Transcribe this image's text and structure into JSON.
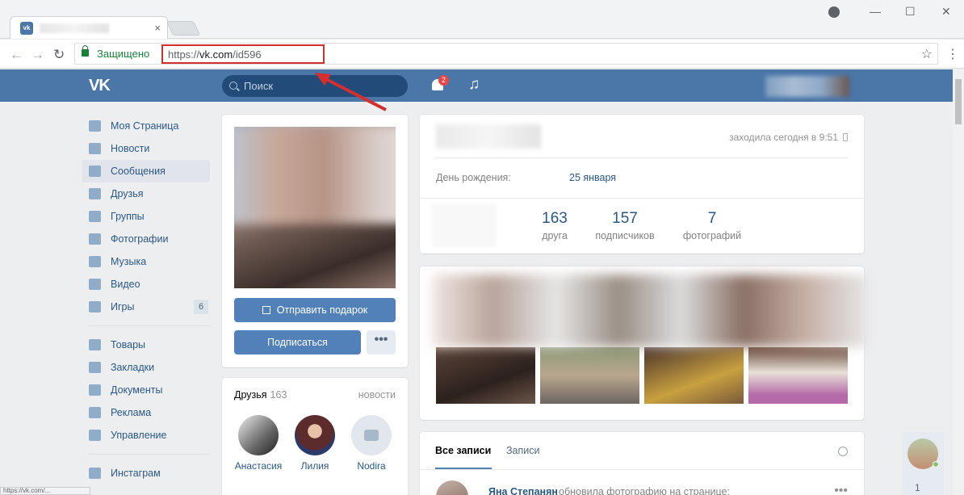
{
  "browser": {
    "url_scheme": "https://",
    "url_domain": "vk.com",
    "url_path": "/id596",
    "secure_label": "Защищено",
    "close_glyph": "×",
    "min_glyph": "—",
    "max_glyph": "☐",
    "win_close_glyph": "✕",
    "back_glyph": "←",
    "forward_glyph": "→",
    "reload_glyph": "↻",
    "star_glyph": "☆",
    "menu_glyph": "⋮",
    "status_url": "https://vk.com/..."
  },
  "header": {
    "logo": "VK",
    "search_placeholder": "Поиск",
    "notifications_count": "2",
    "music_glyph": "♫"
  },
  "menu": {
    "items": [
      {
        "label": "Моя Страница"
      },
      {
        "label": "Новости"
      },
      {
        "label": "Сообщения"
      },
      {
        "label": "Друзья"
      },
      {
        "label": "Группы"
      },
      {
        "label": "Фотографии"
      },
      {
        "label": "Музыка"
      },
      {
        "label": "Видео"
      },
      {
        "label": "Игры",
        "count": "6"
      }
    ],
    "secondary": [
      {
        "label": "Товары"
      },
      {
        "label": "Закладки"
      },
      {
        "label": "Документы"
      },
      {
        "label": "Реклама"
      },
      {
        "label": "Управление"
      }
    ],
    "tertiary": [
      {
        "label": "Инстаграм"
      }
    ]
  },
  "profile": {
    "gift_button": "Отправить подарок",
    "subscribe_button": "Подписаться",
    "more_button": "•••",
    "last_seen": "заходила сегодня в 9:51",
    "birthday_label": "День рождения:",
    "birthday_value": "25 января",
    "stats": [
      {
        "value": "163",
        "label": "друга"
      },
      {
        "value": "157",
        "label": "подписчиков"
      },
      {
        "value": "7",
        "label": "фотографий"
      }
    ]
  },
  "friends": {
    "title": "Друзья",
    "count": "163",
    "news_link": "новости",
    "list": [
      {
        "name": "Анастасия"
      },
      {
        "name": "Лилия"
      },
      {
        "name": "Nodira"
      }
    ]
  },
  "posts": {
    "tab_all": "Все записи",
    "tab_own": "Записи",
    "post_author": "Яна Степанян",
    "post_text": "обновила фотографию на странице:",
    "post_more": "•••"
  },
  "side_widget": {
    "count": "1"
  },
  "colors": {
    "vk_blue": "#4a76a8",
    "button_blue": "#5181b8",
    "link": "#2a5885",
    "highlight_red": "#d32f2f"
  }
}
